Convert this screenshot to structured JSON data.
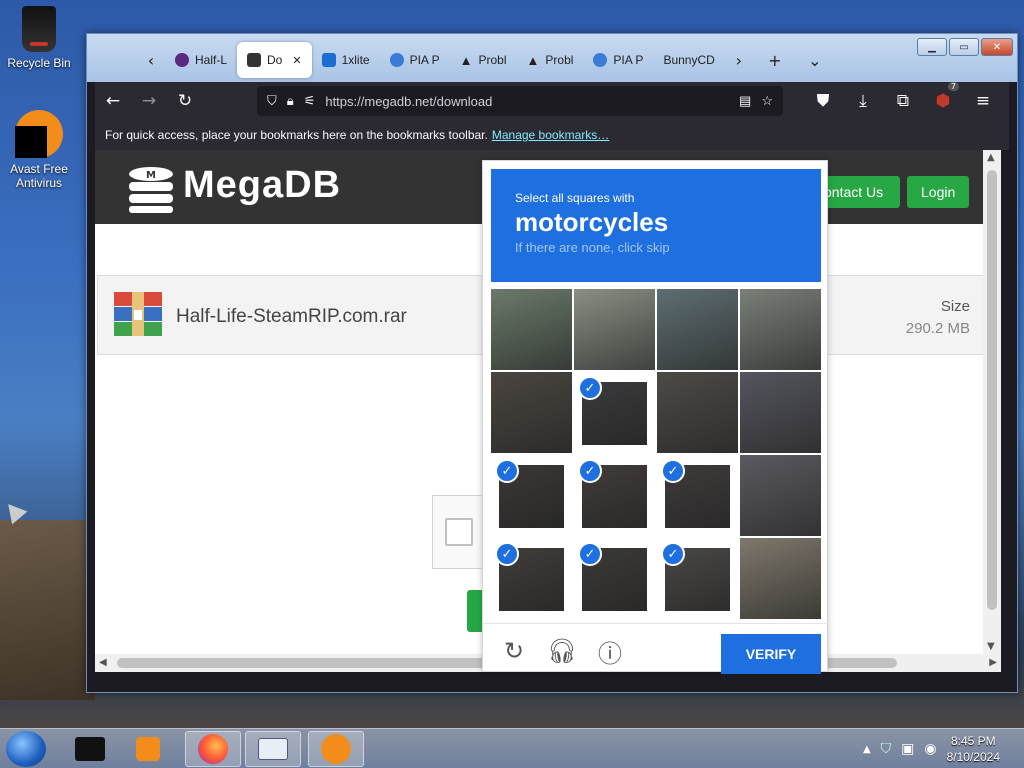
{
  "desktop": {
    "icons": [
      {
        "label": "Recycle Bin"
      },
      {
        "label": "Avast Free Antivirus"
      }
    ]
  },
  "browser": {
    "tabs": [
      {
        "label": "Half-L",
        "color": "#5a2a82"
      },
      {
        "label": "Do",
        "color": "#333333",
        "active": true
      },
      {
        "label": "1xlite",
        "color": "#1c6fd1"
      },
      {
        "label": "PIA P",
        "color": "#3a7bd5"
      },
      {
        "label": "Probl",
        "color": "#000000"
      },
      {
        "label": "Probl",
        "color": "#000000"
      },
      {
        "label": "PIA P",
        "color": "#3a7bd5"
      },
      {
        "label": "BunnyCD",
        "color": "#f7941d"
      }
    ],
    "close_tab_glyph": "✕",
    "url": "https://megadb.net/download",
    "extension_badge": "7",
    "bookmarks_text": "For quick access, place your bookmarks here on the bookmarks toolbar.",
    "bookmarks_link": "Manage bookmarks…"
  },
  "page": {
    "logo": "MegaDB",
    "contact_label": "ontact Us",
    "login_label": "Login",
    "file_name": "Half-Life-SteamRIP.com.rar",
    "size_label": "Size",
    "size_value": "290.2 MB"
  },
  "captcha": {
    "instruction": "Select all squares with",
    "target": "motorcycles",
    "hint": "If there are none, click skip",
    "verify_label": "VERIFY",
    "tiles_selected": [
      false,
      false,
      false,
      false,
      false,
      true,
      false,
      false,
      true,
      true,
      true,
      false,
      true,
      true,
      true,
      false
    ],
    "accent": "#1e6fe0"
  },
  "taskbar": {
    "time": "8:45 PM",
    "date": "8/10/2024"
  }
}
